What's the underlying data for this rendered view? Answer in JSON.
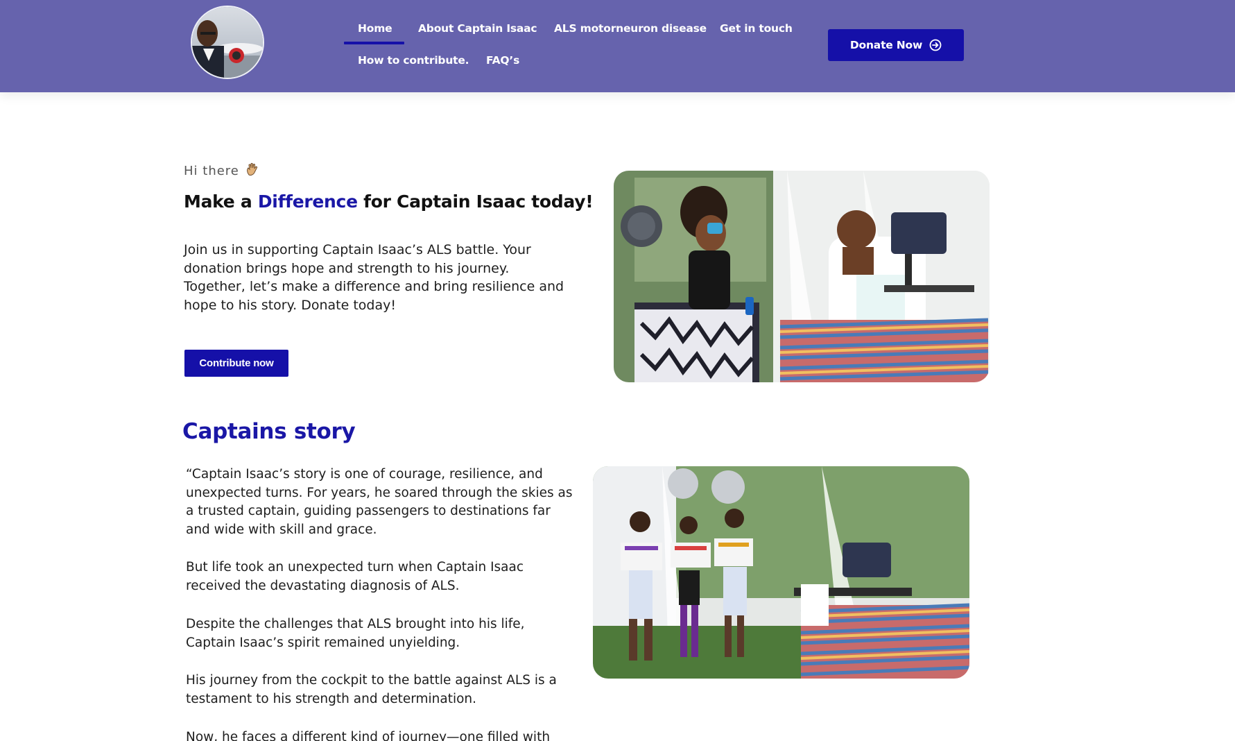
{
  "nav": {
    "items": [
      "Home",
      "About Captain Isaac",
      "ALS motorneuron disease",
      "Get in touch",
      "How to contribute.",
      "FAQ’s"
    ],
    "active": "Home",
    "donate_label": "Donate Now"
  },
  "hero": {
    "greeting": "Hi there",
    "greeting_icon": "waving-hand-icon",
    "headline_before": "Make a ",
    "headline_accent": "Difference",
    "headline_after": " for Captain Isaac today!",
    "intro": "Join us in supporting Captain Isaac’s ALS battle. Your donation brings hope and strength to his journey. Together, let’s make a difference and bring resilience and hope to his story. Donate today!",
    "cta_label": "Contribute now"
  },
  "story": {
    "title": "Captains story",
    "paragraphs": [
      "“Captain Isaac’s story is one of courage, resilience, and unexpected turns. For years, he soared through the skies as a trusted captain, guiding passengers to destinations far and wide with skill and grace.",
      "But life took an unexpected turn when Captain Isaac received the devastating diagnosis of ALS.",
      "Despite the challenges that ALS brought into his life, Captain Isaac’s spirit remained unyielding.",
      "His journey from the cockpit to the battle against ALS is a testament to his strength and determination.",
      "Now, he faces a different kind of journey—one filled with"
    ]
  },
  "colors": {
    "header_bg": "#6663ad",
    "accent": "#1a17a6",
    "button": "#1510a8"
  }
}
